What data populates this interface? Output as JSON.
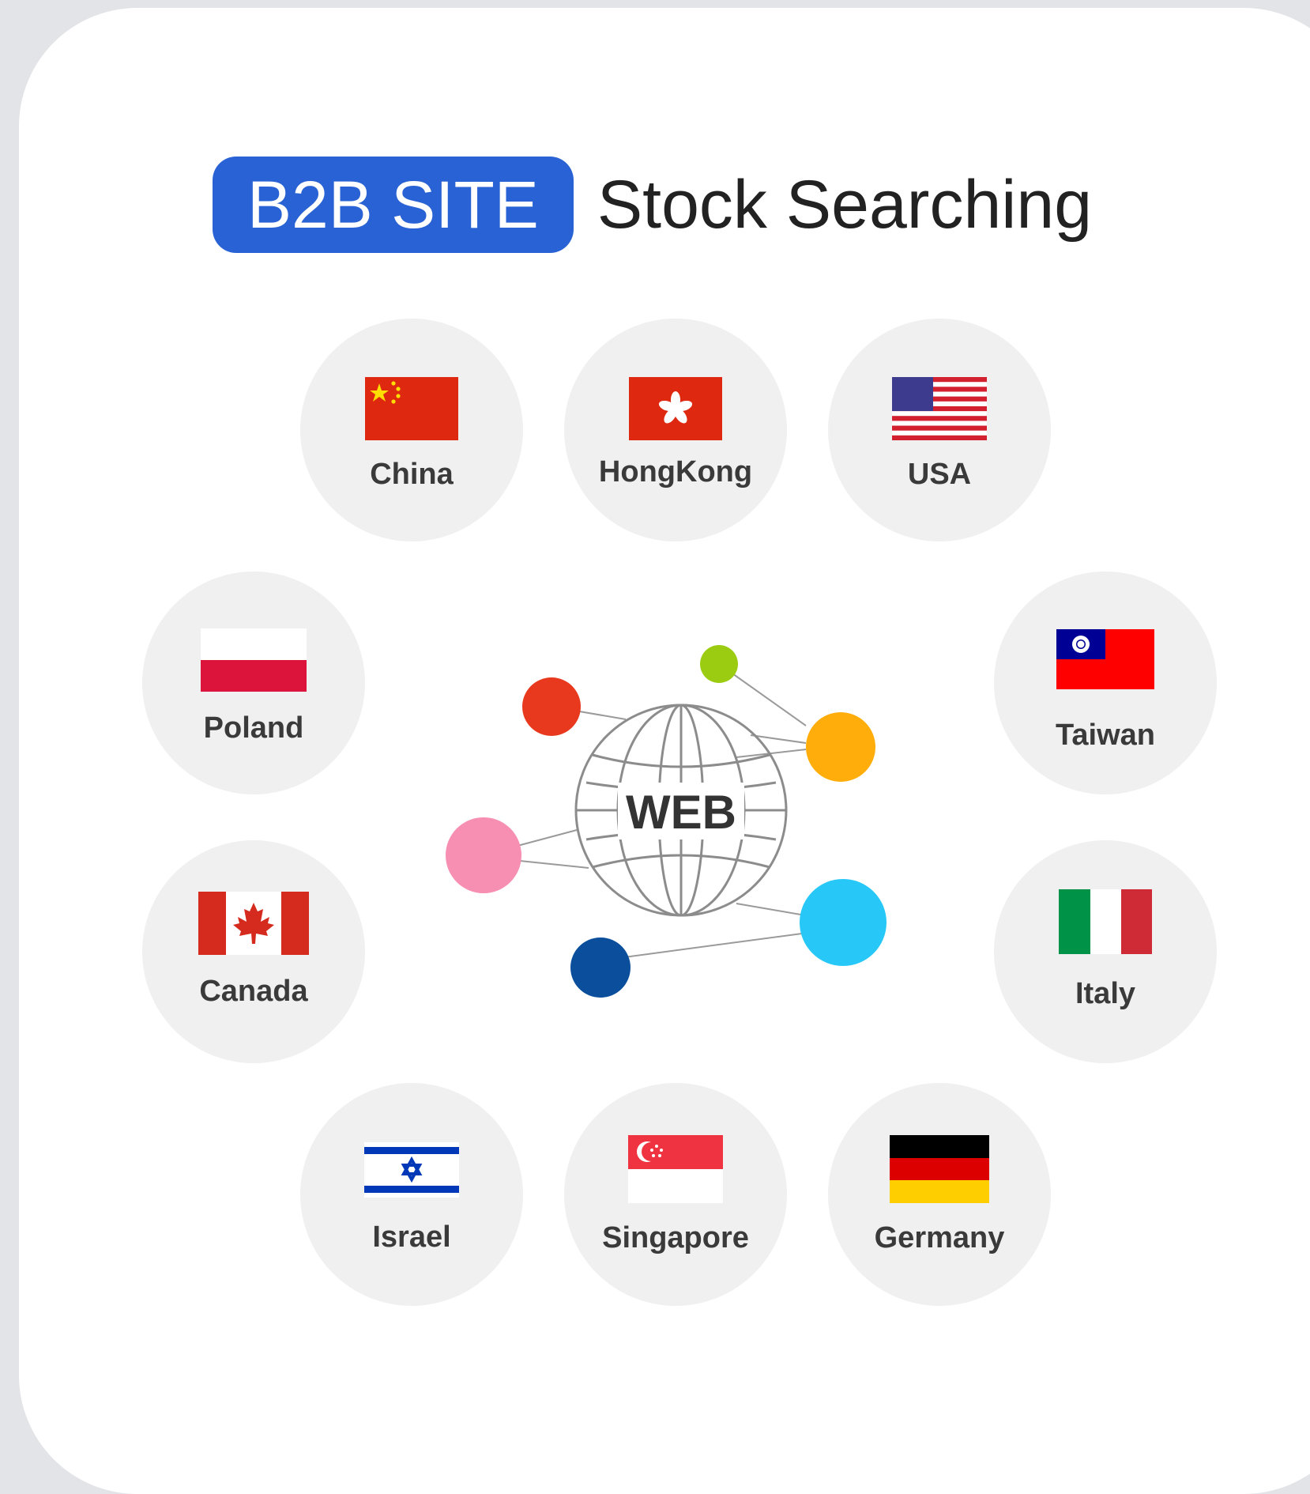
{
  "header": {
    "badge": "B2B SITE",
    "title": "Stock Searching"
  },
  "center": {
    "label": "WEB"
  },
  "countries": [
    {
      "name": "China",
      "flag": "china-flag-icon"
    },
    {
      "name": "HongKong",
      "flag": "hongkong-flag-icon"
    },
    {
      "name": "USA",
      "flag": "usa-flag-icon"
    },
    {
      "name": "Poland",
      "flag": "poland-flag-icon"
    },
    {
      "name": "Taiwan",
      "flag": "taiwan-flag-icon"
    },
    {
      "name": "Canada",
      "flag": "canada-flag-icon"
    },
    {
      "name": "Italy",
      "flag": "italy-flag-icon"
    },
    {
      "name": "Israel",
      "flag": "israel-flag-icon"
    },
    {
      "name": "Singapore",
      "flag": "singapore-flag-icon"
    },
    {
      "name": "Germany",
      "flag": "germany-flag-icon"
    }
  ],
  "colors": {
    "accent": "#2962d4",
    "node_red": "#e8391f",
    "node_green": "#9ccc12",
    "node_orange": "#ffad0a",
    "node_pink": "#f78fb2",
    "node_cyan": "#27c8f8",
    "node_navy": "#0b4f9c"
  }
}
